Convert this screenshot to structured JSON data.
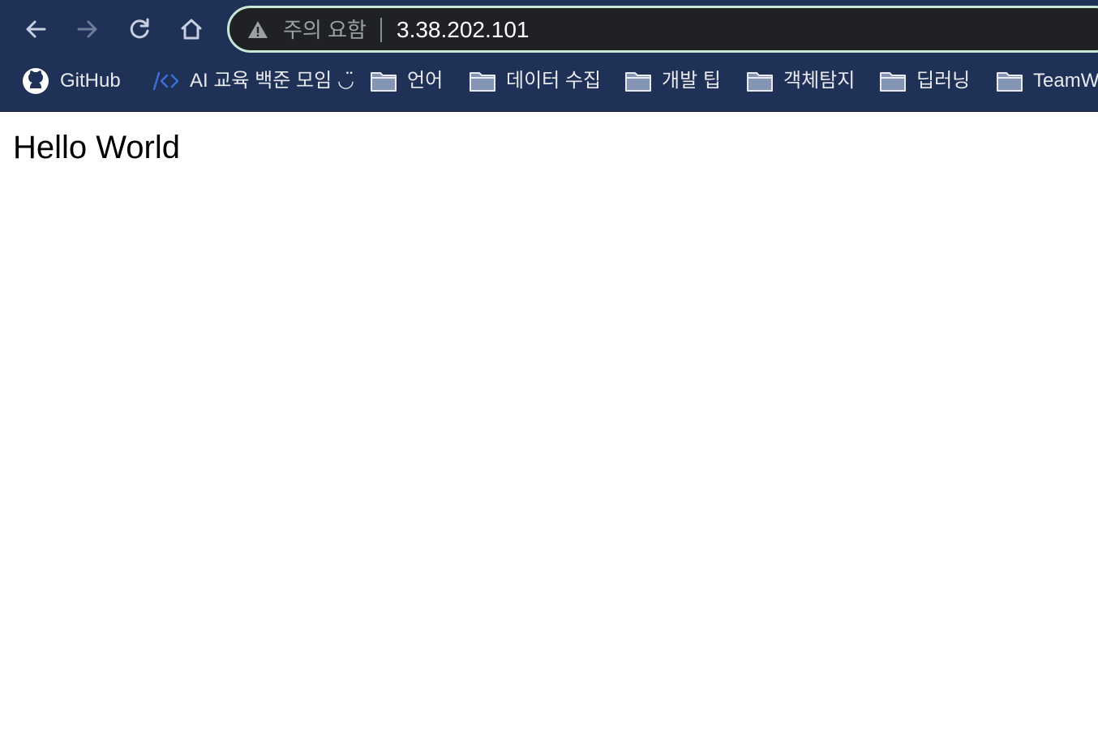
{
  "browser": {
    "nav": {
      "back_icon": "arrow-left-icon",
      "forward_icon": "arrow-right-icon",
      "reload_icon": "reload-icon",
      "home_icon": "home-icon"
    },
    "omnibox": {
      "security_icon": "warning-triangle-icon",
      "security_label": "주의 요함",
      "url": "3.38.202.101"
    },
    "bookmarks": [
      {
        "label": "GitHub",
        "icon": "github-icon"
      },
      {
        "label": "AI 교육 백준 모임 ◡̈",
        "icon": "code-icon"
      },
      {
        "label": "언어",
        "icon": "folder-icon"
      },
      {
        "label": "데이터 수집",
        "icon": "folder-icon"
      },
      {
        "label": "개발 팁",
        "icon": "folder-icon"
      },
      {
        "label": "객체탐지",
        "icon": "folder-icon"
      },
      {
        "label": "딥러닝",
        "icon": "folder-icon"
      },
      {
        "label": "TeamW",
        "icon": "folder-icon"
      }
    ],
    "colors": {
      "toolbar_bg": "#1f3157",
      "omnibox_bg": "#202124",
      "omnibox_border": "#c8e6d6"
    }
  },
  "page": {
    "heading": "Hello World"
  }
}
